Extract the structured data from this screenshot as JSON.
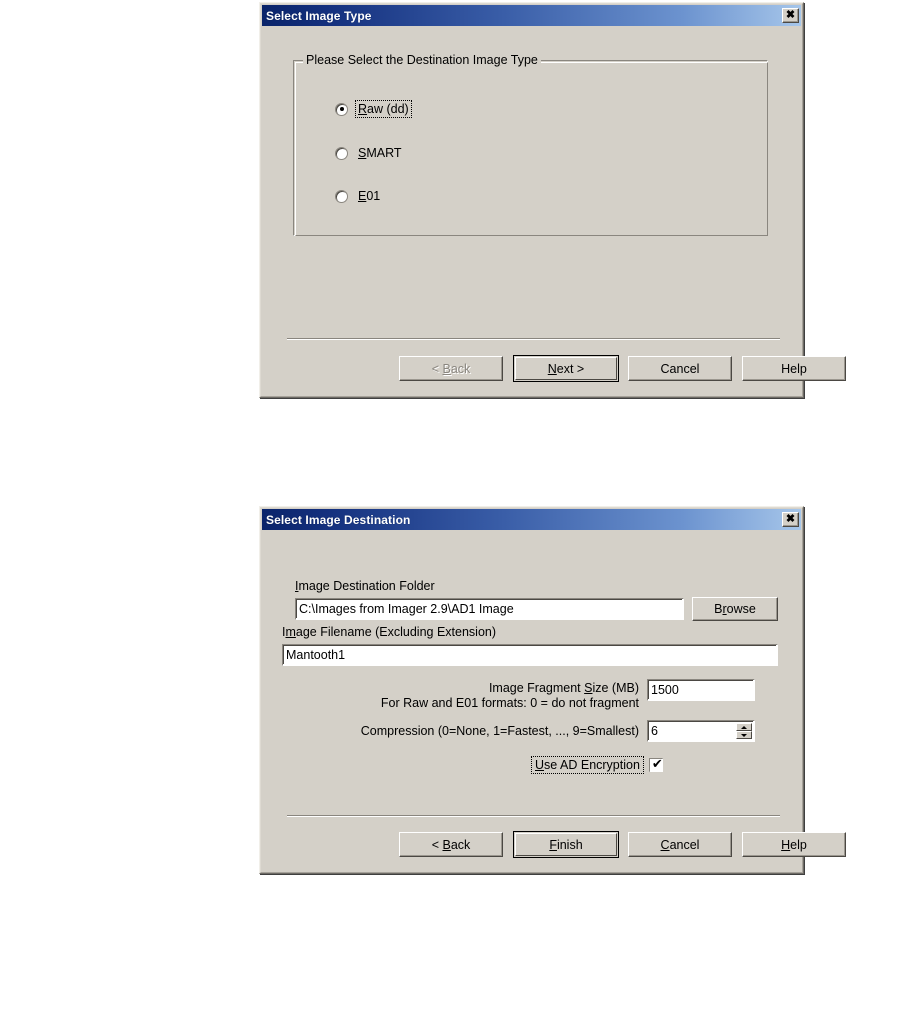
{
  "dialog1": {
    "title": "Select Image Type",
    "close_label": "✕",
    "groupbox_legend_pre": "Please Select the Destination Ima",
    "groupbox_legend_accel": "g",
    "groupbox_legend_post": "e Type",
    "options": [
      {
        "accel": "R",
        "pre": "",
        "post": "aw (dd)",
        "selected": true,
        "focused": true
      },
      {
        "accel": "S",
        "pre": "",
        "post": "MART",
        "selected": false,
        "focused": false
      },
      {
        "accel": "E",
        "pre": "",
        "post": "01",
        "selected": false,
        "focused": false
      }
    ],
    "buttons": [
      {
        "pre": "< ",
        "accel": "B",
        "post": "ack",
        "state": "disabled",
        "name": "back-button"
      },
      {
        "pre": "",
        "accel": "N",
        "post": "ext >",
        "state": "default",
        "name": "next-button"
      },
      {
        "pre": "",
        "accel": "",
        "post": "Cancel",
        "state": "normal",
        "name": "cancel-button"
      },
      {
        "pre": "",
        "accel": "",
        "post": "Help",
        "state": "normal",
        "name": "help-button"
      }
    ]
  },
  "dialog2": {
    "title": "Select Image Destination",
    "close_label": "✕",
    "folder": {
      "label_accel": "I",
      "label_post": "mage Destination Folder",
      "value": "C:\\Images from Imager 2.9\\AD1 Image",
      "browse_pre": "B",
      "browse_accel": "r",
      "browse_post": "owse"
    },
    "filename": {
      "label_pre": "I",
      "label_accel": "m",
      "label_post": "age Filename (Excluding Extension)",
      "value": "Mantooth1"
    },
    "fragment": {
      "label_line1_pre": "Image Fragment ",
      "label_line1_accel": "S",
      "label_line1_post": "ize (MB)",
      "label_line2": "For Raw and E01 formats: 0 = do not fragment",
      "value": "1500"
    },
    "compression": {
      "label_pre": "Compression (0=None, 1=Fastest, ..., 9=Smallest)",
      "value": "6",
      "spin_up": "up-arrow",
      "spin_down": "down-arrow"
    },
    "encryption": {
      "label_pre": "",
      "label_accel": "U",
      "label_post": "se AD Encryption",
      "checked": true,
      "focused": true
    },
    "buttons": [
      {
        "pre": "< ",
        "accel": "B",
        "post": "ack",
        "state": "normal",
        "name": "back-button"
      },
      {
        "pre": "",
        "accel": "F",
        "post": "inish",
        "state": "default",
        "name": "finish-button"
      },
      {
        "pre": "",
        "accel": "C",
        "post": "ancel",
        "state": "normal",
        "name": "cancel-button"
      },
      {
        "pre": "",
        "accel": "H",
        "post": "elp",
        "state": "normal",
        "name": "help-button"
      }
    ]
  }
}
